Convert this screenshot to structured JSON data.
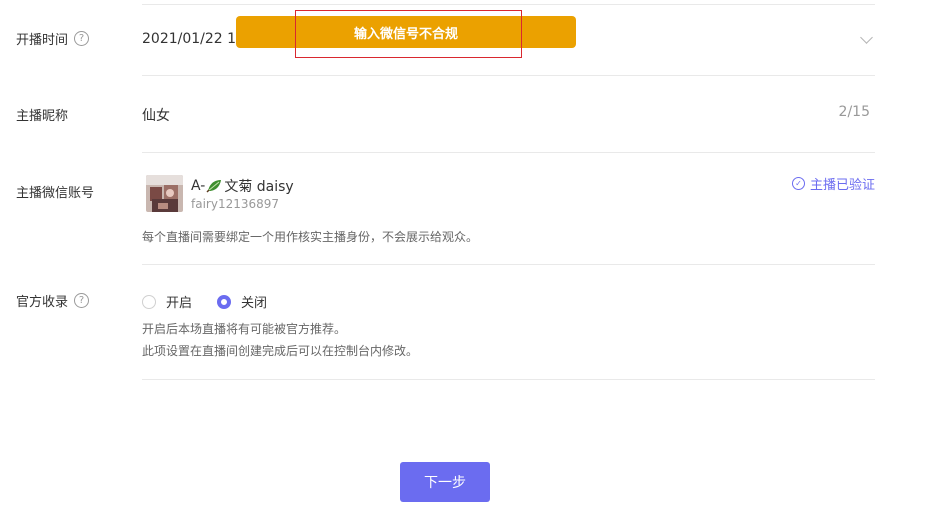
{
  "start_time": {
    "label": "开播时间",
    "help": "?",
    "value": "2021/01/22 15"
  },
  "toast": {
    "message": "输入微信号不合规"
  },
  "nickname": {
    "label": "主播昵称",
    "value": "仙女",
    "counter": "2/15"
  },
  "wechat": {
    "label": "主播微信账号",
    "name_prefix": "A-",
    "name_suffix": "文菊 daisy",
    "account_id": "fairy12136897",
    "verified": "主播已验证",
    "hint": "每个直播间需要绑定一个用作核实主播身份，不会展示给观众。"
  },
  "official": {
    "label": "官方收录",
    "help": "?",
    "options": [
      {
        "label": "开启",
        "selected": false
      },
      {
        "label": "关闭",
        "selected": true
      }
    ],
    "hint_line1": "开启后本场直播将有可能被官方推荐。",
    "hint_line2": "此项设置在直播间创建完成后可以在控制台内修改。"
  },
  "next_button": "下一步",
  "colors": {
    "accent": "#6b6cf0",
    "toast": "#eba100",
    "highlight": "#d9282f"
  }
}
